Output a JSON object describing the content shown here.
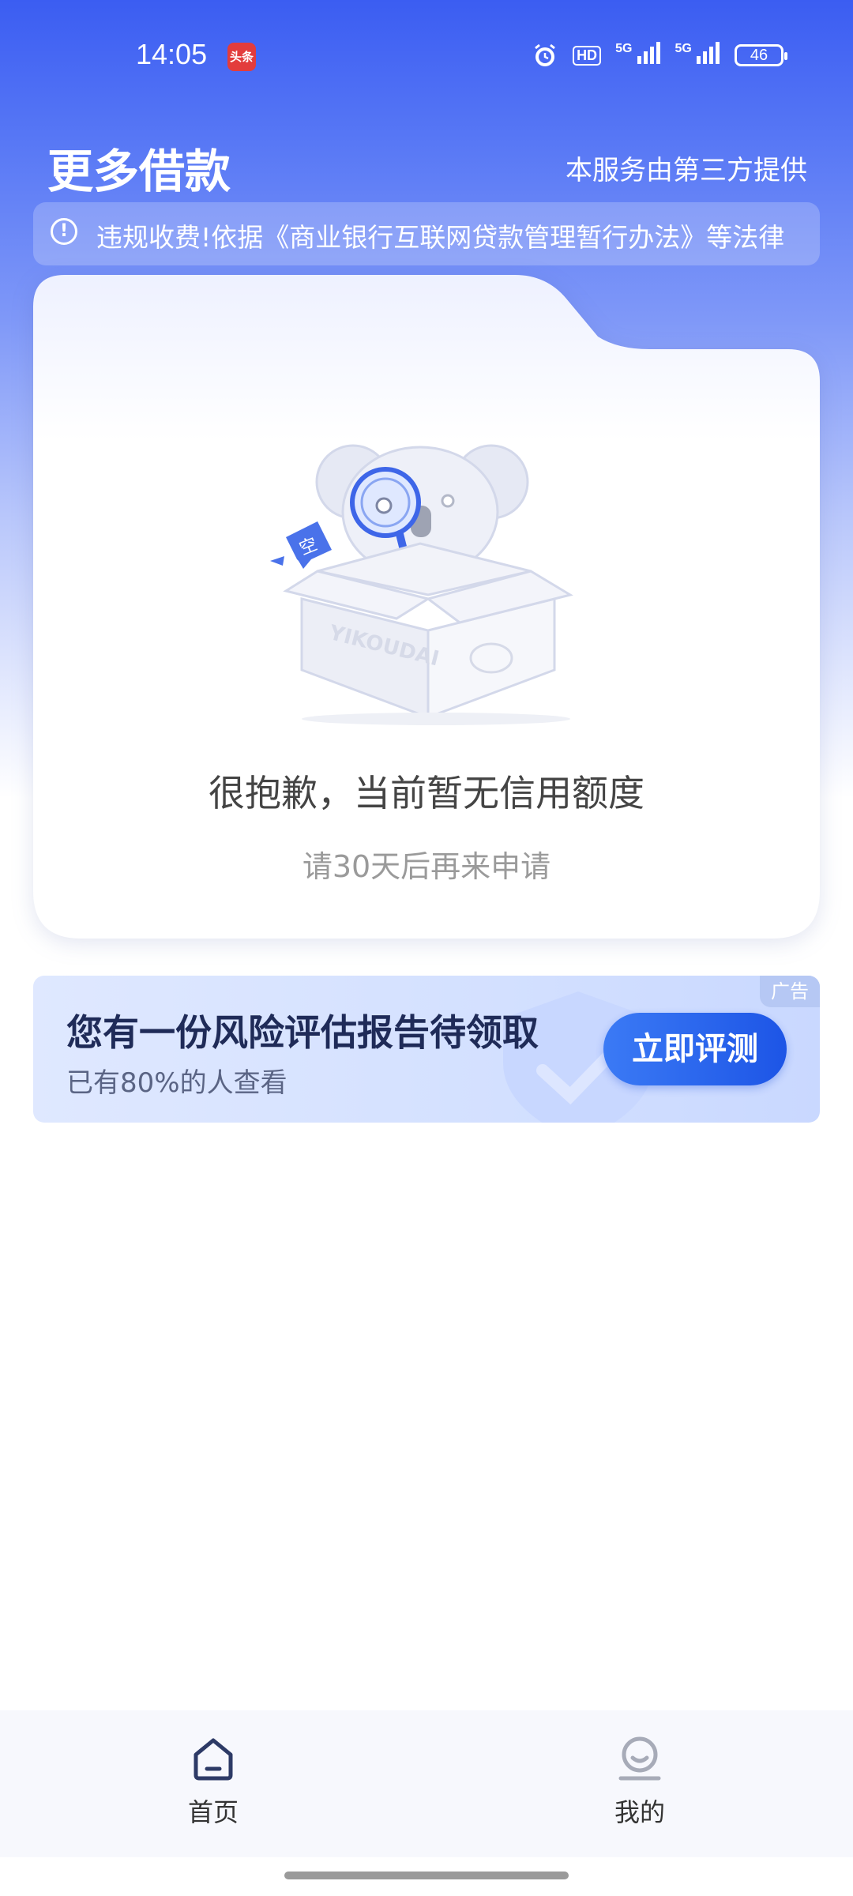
{
  "status_bar": {
    "time": "14:05",
    "app_badge": "头条",
    "hd": "HD",
    "signal1": "5G",
    "signal2": "5G",
    "battery": "46"
  },
  "header": {
    "title": "更多借款",
    "provider_note": "本服务由第三方提供"
  },
  "notice": {
    "icon": "info-icon",
    "text": "违规收费!依据《商业银行互联网贷款管理暂行办法》等法律"
  },
  "empty_state": {
    "title": "很抱歉，当前暂无信用额度",
    "subtitle": "请30天后再来申请",
    "illustration_text": "YIKOUDAI",
    "bubble_text": "空"
  },
  "ad": {
    "tag": "广告",
    "title": "您有一份风险评估报告待领取",
    "subtitle": "已有80%的人查看",
    "button": "立即评测"
  },
  "bottom_nav": {
    "items": [
      {
        "label": "首页",
        "icon": "home-icon",
        "active": true
      },
      {
        "label": "我的",
        "icon": "profile-icon",
        "active": false
      }
    ]
  },
  "colors": {
    "primary": "#3b5df2",
    "button": "#1d55e6",
    "active_nav": "#2d3a66"
  }
}
